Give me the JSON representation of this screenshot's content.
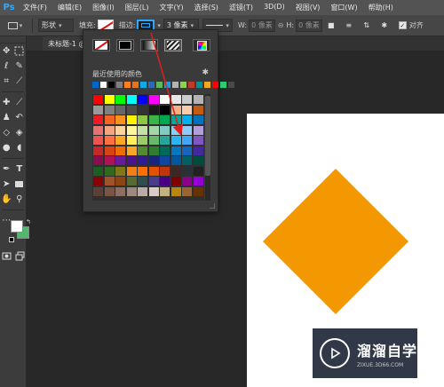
{
  "app": {
    "logo": "Ps"
  },
  "menu": [
    "文件(F)",
    "编辑(E)",
    "图像(I)",
    "图层(L)",
    "文字(Y)",
    "选择(S)",
    "滤镜(T)",
    "3D(D)",
    "视图(V)",
    "窗口(W)",
    "帮助(H)"
  ],
  "options": {
    "mode": "形状",
    "fill_label": "填充:",
    "stroke_label": "描边:",
    "stroke_width": "3 像素",
    "w_label": "W:",
    "w_value": "0 像素",
    "h_label": "H:",
    "h_value": "0 像素",
    "align_label": "对齐"
  },
  "document": {
    "tab": "未标题-1 @"
  },
  "swatch_panel": {
    "recent_label": "最近使用的颜色",
    "recent": [
      "#0066cc",
      "#ffffff",
      "#000000",
      "#7f7f7f",
      "#ff7f27",
      "#e8731f",
      "#12a8e3",
      "#2b6ab8",
      "#5cb85c",
      "#1d9be0",
      "#b3b3b3",
      "#8fd14f",
      "#c0392b",
      "#0b8f8f",
      "#f5a623",
      "#ff0000",
      "#2ecc71",
      "#4a4a4a"
    ],
    "colors": [
      "#ff0000",
      "#ffff00",
      "#00ff00",
      "#00ffff",
      "#0000ff",
      "#ff00ff",
      "#ffffff",
      "#e6e6e6",
      "#cccccc",
      "#b3b3b3",
      "#999999",
      "#808080",
      "#666666",
      "#4d4d4d",
      "#333333",
      "#1a1a1a",
      "#000000",
      "#f4b183",
      "#f8cbad",
      "#c55a11",
      "#ed1c24",
      "#f26522",
      "#f7941d",
      "#fff200",
      "#8dc63f",
      "#39b54a",
      "#00a651",
      "#00a99d",
      "#00aeef",
      "#0072bc",
      "#e57373",
      "#f4a582",
      "#fdd49e",
      "#fff59d",
      "#c5e1a5",
      "#a5d6a7",
      "#80cbc4",
      "#81d4fa",
      "#90caf9",
      "#b39ddb",
      "#ef5350",
      "#ff7043",
      "#ffa726",
      "#ffee58",
      "#9ccc65",
      "#66bb6a",
      "#26a69a",
      "#29b6f6",
      "#42a5f5",
      "#7e57c2",
      "#c62828",
      "#d84315",
      "#ef6c00",
      "#f9a825",
      "#558b2f",
      "#2e7d32",
      "#00695c",
      "#0277bd",
      "#1565c0",
      "#4527a0",
      "#880e4f",
      "#ad1457",
      "#6a1b9a",
      "#4a148c",
      "#311b92",
      "#1a237e",
      "#0d47a1",
      "#01579b",
      "#006064",
      "#004d40",
      "#1b5e20",
      "#33691e",
      "#827717",
      "#f57f17",
      "#ff6f00",
      "#e65100",
      "#bf360c",
      "#3e2723",
      "#263238",
      "#212121",
      "#8b0000",
      "#a0522d",
      "#8b4513",
      "#556b2f",
      "#2f4f4f",
      "#483d8b",
      "#4b0082",
      "#800000",
      "#8b008b",
      "#9400d3",
      "#5d4037",
      "#795548",
      "#8d6e63",
      "#a1887f",
      "#bcaaa4",
      "#d7ccc8",
      "#c2b280",
      "#b8860b",
      "#996633",
      "#663300"
    ]
  },
  "canvas": {
    "background": "#ffffff",
    "shape_color": "#f39800"
  },
  "colors": {
    "foreground": "#ffffff",
    "background": "#4fba6d",
    "accent": "#31a8ff",
    "annotation": "#e0201e"
  },
  "watermark": {
    "title": "溜溜自学",
    "url": "ZIXUE.3D66.COM"
  }
}
